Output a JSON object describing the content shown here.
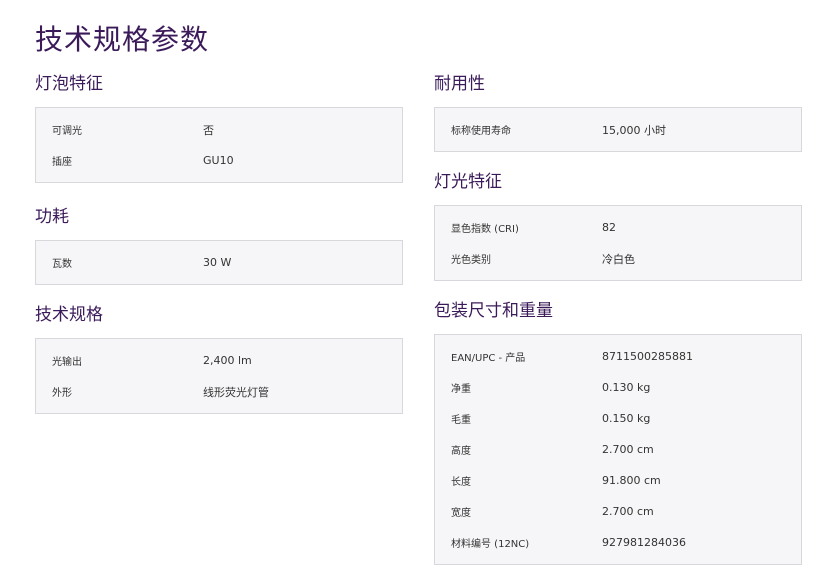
{
  "page": {
    "title": "技术规格参数"
  },
  "left": [
    {
      "title": "灯泡特征",
      "rows": [
        {
          "label": "可调光",
          "value": "否"
        },
        {
          "label": "插座",
          "value": "GU10"
        }
      ]
    },
    {
      "title": "功耗",
      "rows": [
        {
          "label": "瓦数",
          "value": "30  W"
        }
      ]
    },
    {
      "title": "技术规格",
      "rows": [
        {
          "label": "光输出",
          "value": "2,400  lm"
        },
        {
          "label": "外形",
          "value": "线形荧光灯管"
        }
      ]
    }
  ],
  "right": [
    {
      "title": "耐用性",
      "rows": [
        {
          "label": "标称使用寿命",
          "value": "15,000  小时"
        }
      ]
    },
    {
      "title": "灯光特征",
      "rows": [
        {
          "label": "显色指数 (CRI)",
          "value": "82"
        },
        {
          "label": "光色类别",
          "value": "冷白色"
        }
      ]
    },
    {
      "title": "包装尺寸和重量",
      "rows": [
        {
          "label": "EAN/UPC - 产品",
          "value": "8711500285881"
        },
        {
          "label": "净重",
          "value": "0.130  kg"
        },
        {
          "label": "毛重",
          "value": "0.150  kg"
        },
        {
          "label": "高度",
          "value": "2.700  cm"
        },
        {
          "label": "长度",
          "value": "91.800  cm"
        },
        {
          "label": "宽度",
          "value": "2.700  cm"
        },
        {
          "label": "材料编号 (12NC)",
          "value": "927981284036"
        }
      ]
    }
  ]
}
